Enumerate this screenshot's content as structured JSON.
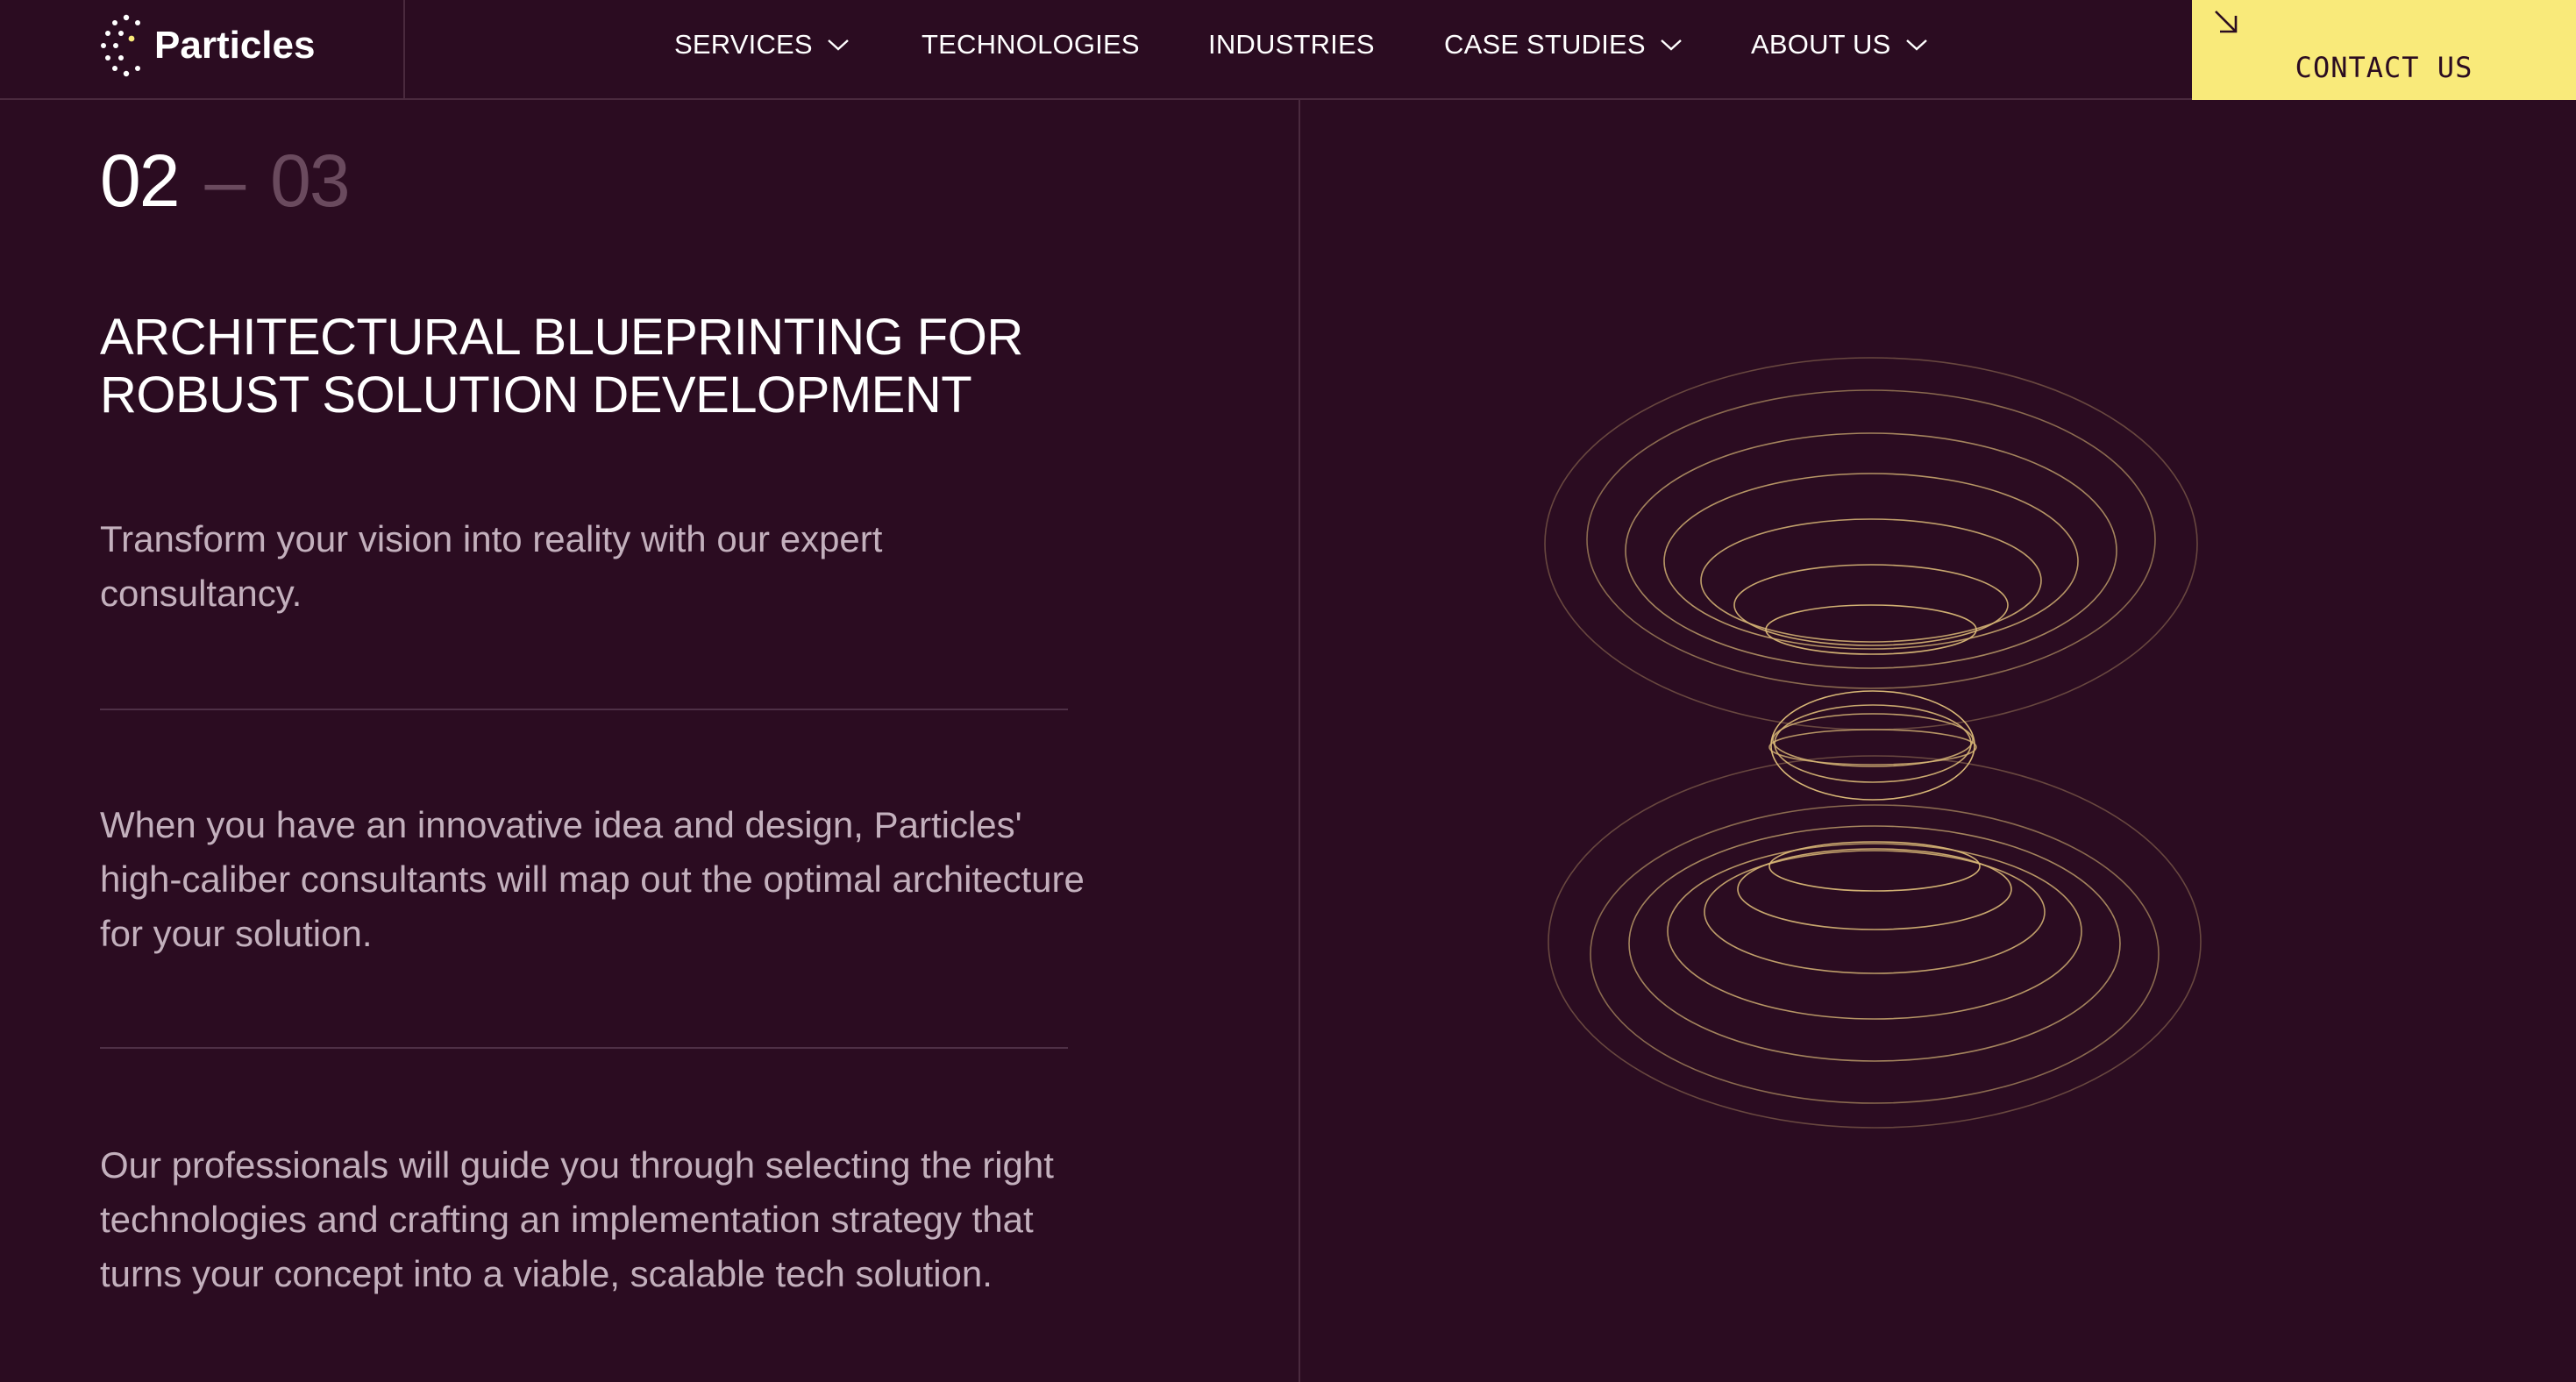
{
  "header": {
    "logo_text": "Particles",
    "nav": [
      {
        "label": "SERVICES",
        "has_dropdown": true
      },
      {
        "label": "TECHNOLOGIES",
        "has_dropdown": false
      },
      {
        "label": "INDUSTRIES",
        "has_dropdown": false
      },
      {
        "label": "CASE STUDIES",
        "has_dropdown": true
      },
      {
        "label": "ABOUT US",
        "has_dropdown": true
      }
    ],
    "contact_label": "CONTACT US",
    "contact_icon": "arrow-down-right-icon"
  },
  "slide": {
    "current": "02",
    "separator": "–",
    "total": "03"
  },
  "content": {
    "title": "ARCHITECTURAL BLUEPRINTING FOR ROBUST SOLUTION DEVELOPMENT",
    "paragraphs": [
      "Transform your vision into reality with our expert consultancy.",
      "When you have an innovative idea and design, Particles' high-caliber consultants will map out the optimal architecture for your solution.",
      "Our professionals will guide you through selecting the right technologies and crafting an implementation strategy that turns your concept into a viable, scalable tech solution."
    ]
  },
  "colors": {
    "background": "#2b0c21",
    "accent": "#f9ea7a",
    "divider": "#4a2a3e",
    "body_text": "#c3b0bd",
    "muted_counter": "#6a4a5e",
    "illustration_stroke": "#d9b877"
  },
  "illustration": {
    "icon": "hourglass-rings-illustration"
  }
}
